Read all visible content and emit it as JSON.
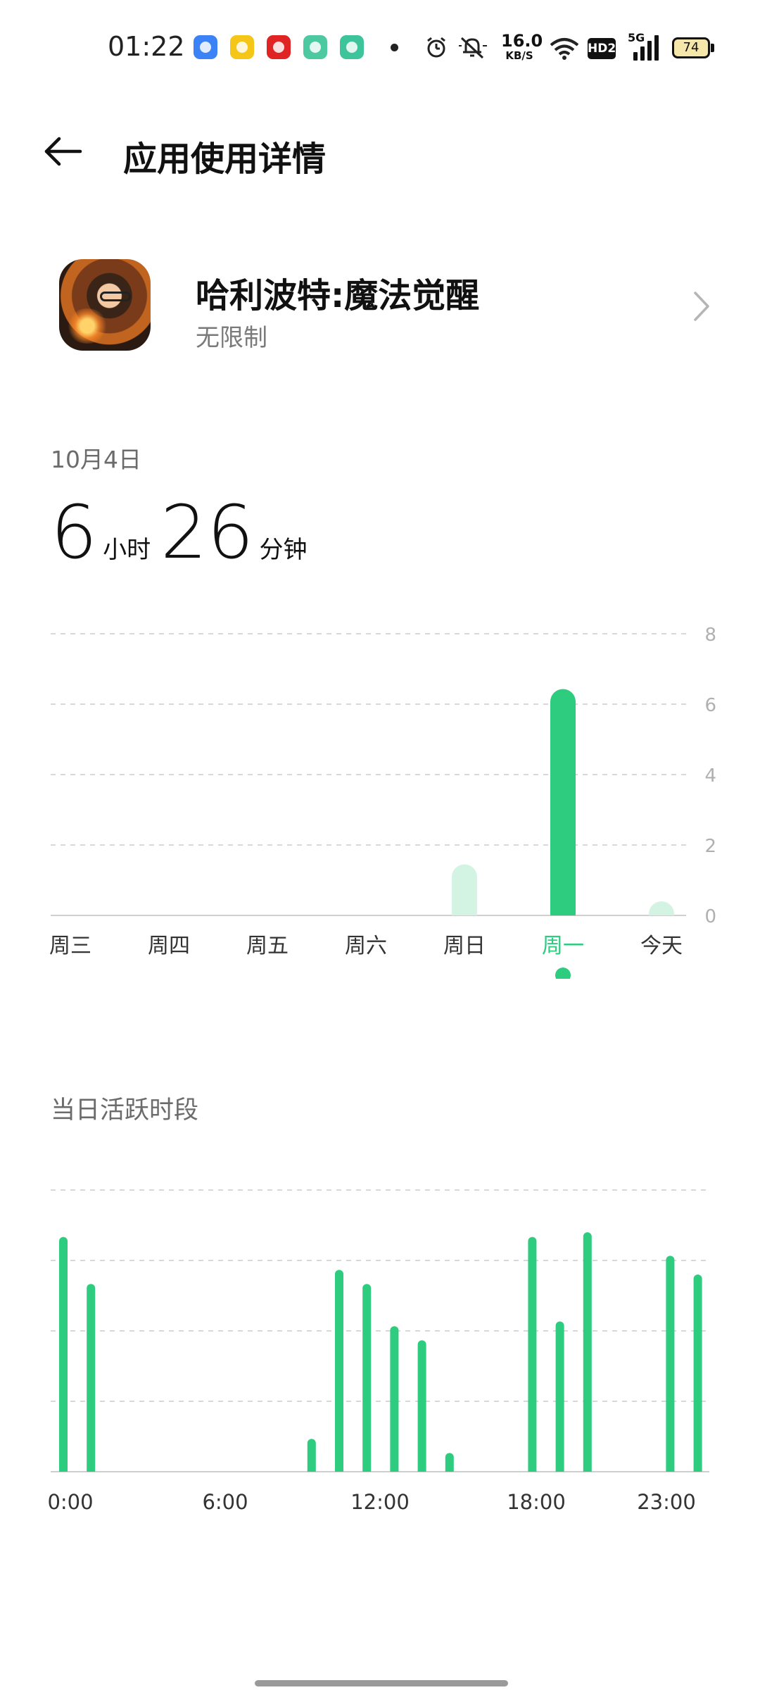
{
  "status_bar": {
    "time": "01:22",
    "net_speed_value": "16.0",
    "net_speed_unit": "KB/S",
    "hd_label": "HD2",
    "network_type": "5G",
    "battery_level": "74",
    "notification_icons": [
      {
        "name": "bubble-app-icon",
        "color": "#3b82f6"
      },
      {
        "name": "notes-app-icon",
        "color": "#f5c518"
      },
      {
        "name": "music-app-icon",
        "color": "#e02424"
      },
      {
        "name": "green-ring-app-icon",
        "color": "#4cc9a0"
      },
      {
        "name": "green-app-icon",
        "color": "#3dc49a"
      }
    ]
  },
  "header": {
    "title": "应用使用详情"
  },
  "app": {
    "name": "哈利波特:魔法觉醒",
    "limit": "无限制"
  },
  "summary": {
    "date": "10月4日",
    "hours": "6",
    "hours_unit": "小时",
    "minutes": "26",
    "minutes_unit": "分钟"
  },
  "colors": {
    "accent": "#2dcc7f",
    "faded": "#d3f3e3",
    "grid": "#d8d8d8",
    "axis_text": "#b0b0b0",
    "label_text": "#333333"
  },
  "chart_data": [
    {
      "type": "bar",
      "categories": [
        "周三",
        "周四",
        "周五",
        "周六",
        "周日",
        "周一",
        "今天"
      ],
      "values": [
        0,
        0,
        0,
        0,
        1.45,
        6.43,
        0.4
      ],
      "selected_index": 5,
      "ylim": [
        0,
        8
      ],
      "yticks": [
        0,
        2,
        4,
        6,
        8
      ],
      "grid": true
    },
    {
      "type": "bar",
      "title": "当日活跃时段",
      "x": [
        0,
        1,
        9,
        10,
        11,
        12,
        13,
        14,
        17,
        18,
        19,
        22,
        23
      ],
      "values": [
        50,
        40,
        7,
        43,
        40,
        31,
        28,
        4,
        50,
        32,
        51,
        46,
        42
      ],
      "x_tick_labels": [
        "0:00",
        "6:00",
        "12:00",
        "18:00",
        "23:00"
      ],
      "ylim": [
        0,
        60
      ],
      "grid": true
    }
  ],
  "activity": {
    "title": "当日活跃时段"
  }
}
